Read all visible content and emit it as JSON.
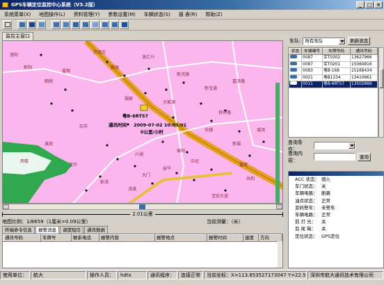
{
  "window": {
    "title": "GPS车辆定位监控中心系统（V3.2版）"
  },
  "menu": [
    "系统菜单(X)",
    "地图操作(L)",
    "资料管理(Y)",
    "参数设置(M)",
    "车辆状态(S)",
    "报 表(R)",
    "帮助(Z)"
  ],
  "toolbar": {
    "icons": [
      "select-icon",
      "zoom-in-icon",
      "zoom-out-icon",
      "pan-icon",
      "measure-icon",
      "print-icon",
      "search-icon",
      "zoom-box-icon",
      "refresh-icon",
      "locate-icon",
      "track-icon",
      "settings-icon"
    ]
  },
  "map_tab": "监控主窗口",
  "map": {
    "labels": [
      "洛阳",
      "新阳",
      "开发区",
      "洛汇兴",
      "铁仔路",
      "鹤翔",
      "盖翔",
      "鹏强",
      "新鸿源",
      "新宝通",
      "富泽路",
      "福家",
      "大家源",
      "东辅",
      "石市",
      "新福",
      "振阳",
      "宝华",
      "六湖",
      "中冠",
      "新湾",
      "湾溪",
      "宝安大道",
      "共和",
      "富荣",
      "大门",
      "益华",
      "溪南",
      "西楼",
      "城湾"
    ],
    "vehicle_label": "粤B-6RT57",
    "callout": {
      "line1_label": "通讯时间",
      "line1_value": "2009-07-02 10:05:01",
      "line2": "0公里/小时"
    }
  },
  "scale": {
    "label": "2.01公里"
  },
  "map_status": {
    "ratio": "地图比例：1/8659（1厘米=0.09公里）",
    "measure": "当前测量：（米）"
  },
  "bottom_tabs": [
    "终端命令信息",
    "报警消息",
    "调度短信",
    "通讯数据"
  ],
  "bottom_table": {
    "columns": [
      "通讯号码",
      "车牌号",
      "联系电话",
      "报警内容",
      "报警地点",
      "报警时间",
      "速度",
      "方向"
    ]
  },
  "right": {
    "fleet_label": "车队:",
    "fleet_value": "所有车队",
    "refresh_button": "刷新状态",
    "vehicle_table": {
      "columns": [
        "状态",
        "车辆编号",
        "车牌号码",
        "通讯号码"
      ],
      "rows": [
        [
          "",
          "0087",
          "军T0302",
          "13627966"
        ],
        [
          "",
          "0087",
          "军T0201",
          "15060816"
        ],
        [
          "",
          "0083",
          "粤B-168",
          "15168434"
        ],
        [
          "",
          "0021",
          "粤B1234",
          "13410661"
        ],
        [
          "",
          "0011",
          "粤B-6RT57",
          "13502866"
        ]
      ],
      "selected_index": 4
    },
    "query_cond_label": "查询条件：",
    "query_content_label": "查询内容：",
    "query_button": "查询",
    "detail": [
      [
        "ACC 状态：",
        "熄火"
      ],
      [
        "车门状态：",
        "关"
      ],
      [
        "车辆电路：",
        "断路"
      ],
      [
        "油点状态：",
        "正常"
      ],
      [
        "变码警车：",
        "未警车"
      ],
      [
        "车辆电路：",
        "正常"
      ],
      [
        "前 灯 光：",
        "关"
      ],
      [
        "后 尾 箱：",
        "关"
      ],
      [
        "定位状态：",
        "GPS定位"
      ]
    ]
  },
  "statusbar": {
    "unit_label": "使用单位：",
    "unit_value": "航大",
    "operator_label": "操作人员：",
    "operator_value": "hdtx",
    "comm_label": "通讯程序：",
    "conn_status": "连接正常",
    "coords": "当前坐标：X=113.853527173047  Y=22.592958797659",
    "company": "深圳市航大通讯技术有限公司"
  }
}
